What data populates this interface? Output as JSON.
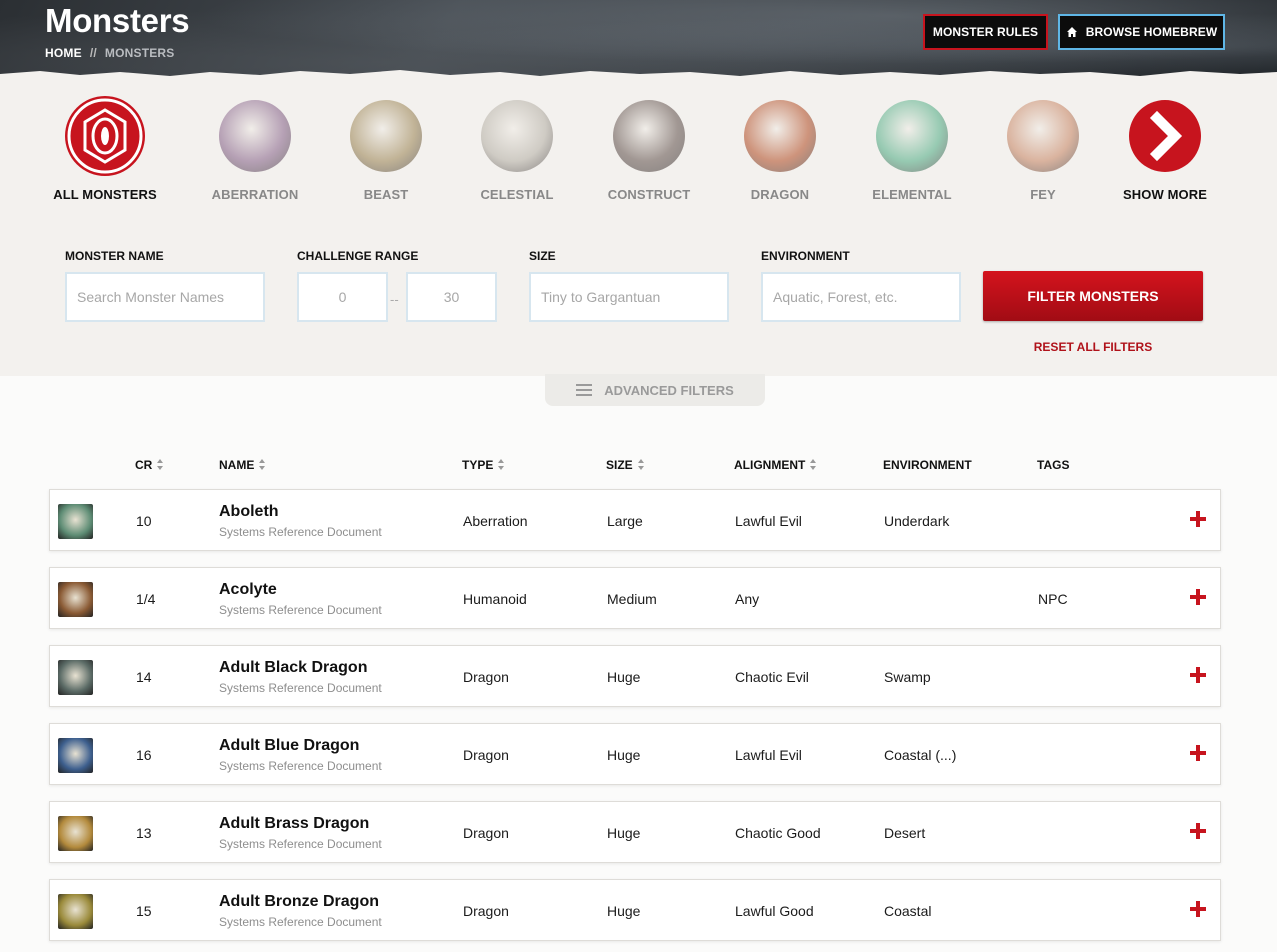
{
  "header": {
    "title": "Monsters",
    "breadcrumb": {
      "home": "HOME",
      "separator": "//",
      "current": "MONSTERS"
    },
    "buttons": {
      "rules": "MONSTER RULES",
      "homebrew": "BROWSE HOMEBREW"
    }
  },
  "categories": [
    {
      "label": "ALL MONSTERS",
      "icon": "eye-emblem-icon",
      "color": "#c7141e",
      "active": true
    },
    {
      "label": "ABERRATION",
      "icon": "aberration-portrait",
      "color": "#8d6b8f"
    },
    {
      "label": "BEAST",
      "icon": "beast-portrait",
      "color": "#a08a5c"
    },
    {
      "label": "CELESTIAL",
      "icon": "celestial-portrait",
      "color": "#b7b2a8"
    },
    {
      "label": "CONSTRUCT",
      "icon": "construct-portrait",
      "color": "#6b5c57"
    },
    {
      "label": "DRAGON",
      "icon": "dragon-portrait",
      "color": "#b5552f"
    },
    {
      "label": "ELEMENTAL",
      "icon": "elemental-portrait",
      "color": "#59b08a"
    },
    {
      "label": "FEY",
      "icon": "fey-portrait",
      "color": "#c98a6a"
    },
    {
      "label": "SHOW MORE",
      "icon": "chevron-right-icon",
      "color": "#c7141e"
    }
  ],
  "filters": {
    "name": {
      "label": "MONSTER NAME",
      "placeholder": "Search Monster Names"
    },
    "challenge": {
      "label": "CHALLENGE RANGE",
      "min": "0",
      "separator": "--",
      "max": "30"
    },
    "size": {
      "label": "SIZE",
      "placeholder": "Tiny to Gargantuan"
    },
    "environment": {
      "label": "ENVIRONMENT",
      "placeholder": "Aquatic, Forest, etc."
    },
    "submit": "FILTER MONSTERS",
    "reset": "RESET ALL FILTERS",
    "advanced": "ADVANCED FILTERS"
  },
  "table": {
    "columns": [
      "CR",
      "NAME",
      "TYPE",
      "SIZE",
      "ALIGNMENT",
      "ENVIRONMENT",
      "TAGS"
    ],
    "rows": [
      {
        "cr": "10",
        "name": "Aboleth",
        "source": "Systems Reference Document",
        "type": "Aberration",
        "size": "Large",
        "alignment": "Lawful Evil",
        "environment": "Underdark",
        "tags": "",
        "thumb": "#5d8c74"
      },
      {
        "cr": "1/4",
        "name": "Acolyte",
        "source": "Systems Reference Document",
        "type": "Humanoid",
        "size": "Medium",
        "alignment": "Any",
        "environment": "",
        "tags": "NPC",
        "thumb": "#8a5a34"
      },
      {
        "cr": "14",
        "name": "Adult Black Dragon",
        "source": "Systems Reference Document",
        "type": "Dragon",
        "size": "Huge",
        "alignment": "Chaotic Evil",
        "environment": "Swamp",
        "tags": "",
        "thumb": "#5b6b66"
      },
      {
        "cr": "16",
        "name": "Adult Blue Dragon",
        "source": "Systems Reference Document",
        "type": "Dragon",
        "size": "Huge",
        "alignment": "Lawful Evil",
        "environment": "Coastal (...)",
        "tags": "",
        "thumb": "#3d5f8e"
      },
      {
        "cr": "13",
        "name": "Adult Brass Dragon",
        "source": "Systems Reference Document",
        "type": "Dragon",
        "size": "Huge",
        "alignment": "Chaotic Good",
        "environment": "Desert",
        "tags": "",
        "thumb": "#b38a3c"
      },
      {
        "cr": "15",
        "name": "Adult Bronze Dragon",
        "source": "Systems Reference Document",
        "type": "Dragon",
        "size": "Huge",
        "alignment": "Lawful Good",
        "environment": "Coastal",
        "tags": "",
        "thumb": "#9a8a3a"
      }
    ]
  }
}
